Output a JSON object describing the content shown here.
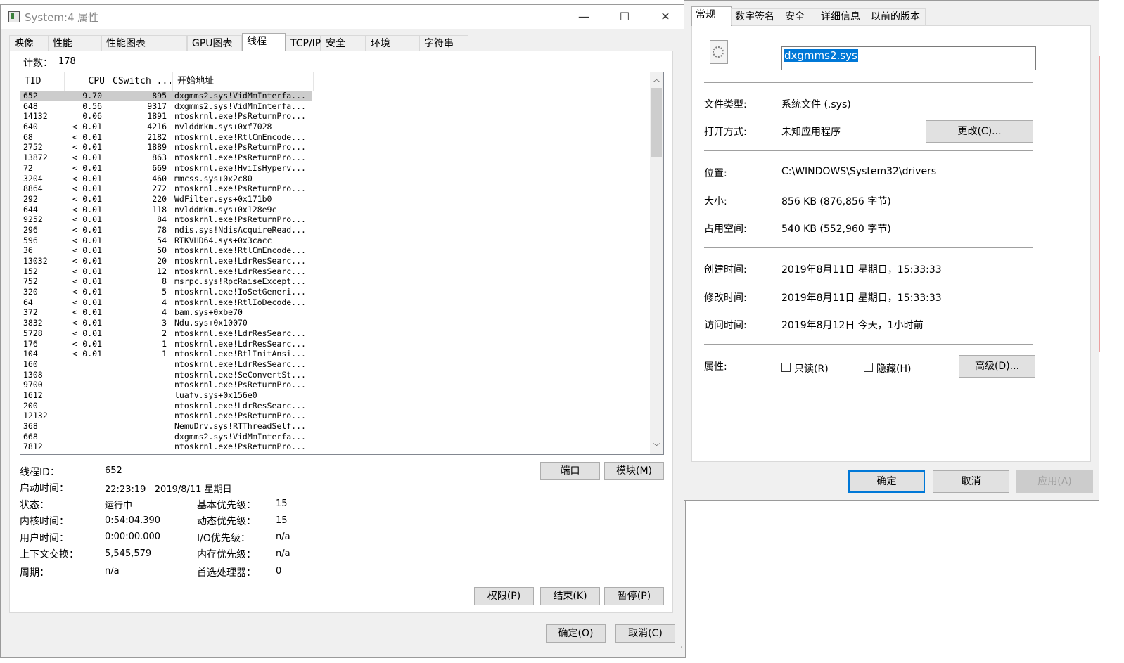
{
  "left_window": {
    "title": "System:4 属性",
    "title_buttons": {
      "minimize": "—",
      "maximize": "☐",
      "close": "✕"
    },
    "tabs": [
      "映像",
      "性能",
      "性能图表",
      "GPU图表",
      "线程",
      "TCP/IP",
      "安全",
      "环境",
      "字符串"
    ],
    "active_tab": "线程",
    "count_label": "计数：",
    "count_value": "178",
    "columns": {
      "tid": "TID",
      "cpu": "CPU",
      "cswitch": "CSwitch ...",
      "start": "开始地址"
    },
    "rows": [
      {
        "tid": "652",
        "lt": "",
        "cpu": "9.70",
        "cs": "895",
        "addr": "dxgmms2.sys!VidMmInterfa..."
      },
      {
        "tid": "648",
        "lt": "",
        "cpu": "0.56",
        "cs": "9317",
        "addr": "dxgmms2.sys!VidMmInterfa..."
      },
      {
        "tid": "14132",
        "lt": "",
        "cpu": "0.06",
        "cs": "1891",
        "addr": "ntoskrnl.exe!PsReturnPro..."
      },
      {
        "tid": "640",
        "lt": "<",
        "cpu": "0.01",
        "cs": "4216",
        "addr": "nvlddmkm.sys+0xf7028"
      },
      {
        "tid": "68",
        "lt": "<",
        "cpu": "0.01",
        "cs": "2182",
        "addr": "ntoskrnl.exe!RtlCmEncode..."
      },
      {
        "tid": "2752",
        "lt": "<",
        "cpu": "0.01",
        "cs": "1889",
        "addr": "ntoskrnl.exe!PsReturnPro..."
      },
      {
        "tid": "13872",
        "lt": "<",
        "cpu": "0.01",
        "cs": "863",
        "addr": "ntoskrnl.exe!PsReturnPro..."
      },
      {
        "tid": "72",
        "lt": "<",
        "cpu": "0.01",
        "cs": "669",
        "addr": "ntoskrnl.exe!HviIsHyperv..."
      },
      {
        "tid": "3204",
        "lt": "<",
        "cpu": "0.01",
        "cs": "460",
        "addr": "mmcss.sys+0x2c80"
      },
      {
        "tid": "8864",
        "lt": "<",
        "cpu": "0.01",
        "cs": "272",
        "addr": "ntoskrnl.exe!PsReturnPro..."
      },
      {
        "tid": "292",
        "lt": "<",
        "cpu": "0.01",
        "cs": "220",
        "addr": "WdFilter.sys+0x171b0"
      },
      {
        "tid": "644",
        "lt": "<",
        "cpu": "0.01",
        "cs": "118",
        "addr": "nvlddmkm.sys+0x128e9c"
      },
      {
        "tid": "9252",
        "lt": "<",
        "cpu": "0.01",
        "cs": "84",
        "addr": "ntoskrnl.exe!PsReturnPro..."
      },
      {
        "tid": "296",
        "lt": "<",
        "cpu": "0.01",
        "cs": "78",
        "addr": "ndis.sys!NdisAcquireRead..."
      },
      {
        "tid": "596",
        "lt": "<",
        "cpu": "0.01",
        "cs": "54",
        "addr": "RTKVHD64.sys+0x3cacc"
      },
      {
        "tid": "36",
        "lt": "<",
        "cpu": "0.01",
        "cs": "50",
        "addr": "ntoskrnl.exe!RtlCmEncode..."
      },
      {
        "tid": "13032",
        "lt": "<",
        "cpu": "0.01",
        "cs": "20",
        "addr": "ntoskrnl.exe!LdrResSearc..."
      },
      {
        "tid": "152",
        "lt": "<",
        "cpu": "0.01",
        "cs": "12",
        "addr": "ntoskrnl.exe!LdrResSearc..."
      },
      {
        "tid": "752",
        "lt": "<",
        "cpu": "0.01",
        "cs": "8",
        "addr": "msrpc.sys!RpcRaiseExcept..."
      },
      {
        "tid": "320",
        "lt": "<",
        "cpu": "0.01",
        "cs": "5",
        "addr": "ntoskrnl.exe!IoSetGeneri..."
      },
      {
        "tid": "64",
        "lt": "<",
        "cpu": "0.01",
        "cs": "4",
        "addr": "ntoskrnl.exe!RtlIoDecode..."
      },
      {
        "tid": "372",
        "lt": "<",
        "cpu": "0.01",
        "cs": "4",
        "addr": "bam.sys+0xbe70"
      },
      {
        "tid": "3832",
        "lt": "<",
        "cpu": "0.01",
        "cs": "3",
        "addr": "Ndu.sys+0x10070"
      },
      {
        "tid": "5728",
        "lt": "<",
        "cpu": "0.01",
        "cs": "2",
        "addr": "ntoskrnl.exe!LdrResSearc..."
      },
      {
        "tid": "176",
        "lt": "<",
        "cpu": "0.01",
        "cs": "1",
        "addr": "ntoskrnl.exe!LdrResSearc..."
      },
      {
        "tid": "104",
        "lt": "<",
        "cpu": "0.01",
        "cs": "1",
        "addr": "ntoskrnl.exe!RtlInitAnsi..."
      },
      {
        "tid": "160",
        "lt": "",
        "cpu": "",
        "cs": "",
        "addr": "ntoskrnl.exe!LdrResSearc..."
      },
      {
        "tid": "1308",
        "lt": "",
        "cpu": "",
        "cs": "",
        "addr": "ntoskrnl.exe!SeConvertSt..."
      },
      {
        "tid": "9700",
        "lt": "",
        "cpu": "",
        "cs": "",
        "addr": "ntoskrnl.exe!PsReturnPro..."
      },
      {
        "tid": "1612",
        "lt": "",
        "cpu": "",
        "cs": "",
        "addr": "luafv.sys+0x156e0"
      },
      {
        "tid": "200",
        "lt": "",
        "cpu": "",
        "cs": "",
        "addr": "ntoskrnl.exe!LdrResSearc..."
      },
      {
        "tid": "12132",
        "lt": "",
        "cpu": "",
        "cs": "",
        "addr": "ntoskrnl.exe!PsReturnPro..."
      },
      {
        "tid": "368",
        "lt": "",
        "cpu": "",
        "cs": "",
        "addr": "NemuDrv.sys!RTThreadSelf..."
      },
      {
        "tid": "668",
        "lt": "",
        "cpu": "",
        "cs": "",
        "addr": "dxgmms2.sys!VidMmInterfa..."
      },
      {
        "tid": "7812",
        "lt": "",
        "cpu": "",
        "cs": "",
        "addr": "ntoskrnl.exe!PsReturnPro..."
      }
    ],
    "thread_info": {
      "thread_id_label": "线程ID：",
      "thread_id": "652",
      "start_time_label": "启动时间：",
      "start_time": "22:23:19   2019/8/11 星期日",
      "state_label": "状态：",
      "state": "运行中",
      "base_prio_label": "基本优先级：",
      "base_prio": "15",
      "kernel_time_label": "内核时间：",
      "kernel_time": "0:54:04.390",
      "dyn_prio_label": "动态优先级：",
      "dyn_prio": "15",
      "user_time_label": "用户时间：",
      "user_time": "0:00:00.000",
      "io_prio_label": "I/O优先级：",
      "io_prio": "n/a",
      "ctx_label": "上下文交换：",
      "ctx": "5,545,579",
      "mem_prio_label": "内存优先级：",
      "mem_prio": "n/a",
      "cycles_label": "周期：",
      "cycles": "n/a",
      "ideal_proc_label": "首选处理器：",
      "ideal_proc": "0"
    },
    "buttons": {
      "stack": "端口",
      "module": "模块(M)",
      "permissions": "权限(P)",
      "kill": "结束(K)",
      "suspend": "暂停(P)",
      "ok": "确定(O)",
      "cancel": "取消(C)"
    }
  },
  "right_window": {
    "tabs": [
      "常规",
      "数字签名",
      "安全",
      "详细信息",
      "以前的版本"
    ],
    "active_tab": "常规",
    "file_name": "dxgmms2.sys",
    "file_type_label": "文件类型:",
    "file_type": "系统文件 (.sys)",
    "open_with_label": "打开方式:",
    "open_with": "未知应用程序",
    "change_button": "更改(C)...",
    "location_label": "位置:",
    "location": "C:\\WINDOWS\\System32\\drivers",
    "size_label": "大小:",
    "size": "856 KB (876,856 字节)",
    "disk_size_label": "占用空间:",
    "disk_size": "540 KB (552,960 字节)",
    "created_label": "创建时间:",
    "created": "2019年8月11日 星期日，15:33:33",
    "modified_label": "修改时间:",
    "modified": "2019年8月11日 星期日，15:33:33",
    "accessed_label": "访问时间:",
    "accessed": "2019年8月12日 今天，1小时前",
    "attributes_label": "属性:",
    "readonly_label": "只读(R)",
    "hidden_label": "隐藏(H)",
    "advanced_button": "高级(D)...",
    "ok_button": "确定",
    "cancel_button": "取消",
    "apply_button": "应用(A)"
  },
  "colors": {
    "selection": "#0078d7",
    "window_bg": "#f0f0f0"
  }
}
